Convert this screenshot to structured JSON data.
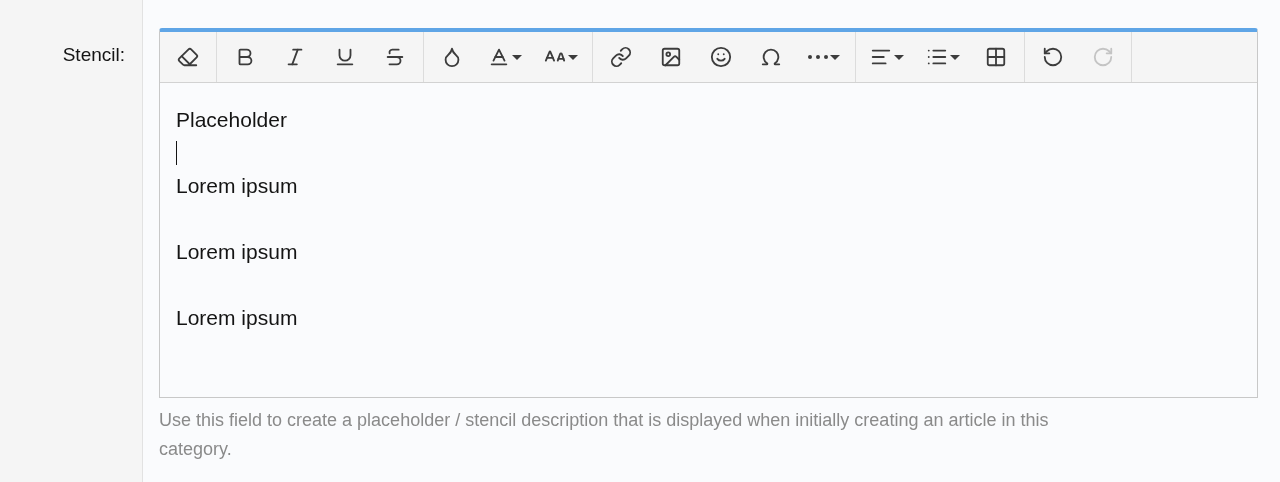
{
  "field": {
    "label": "Stencil:"
  },
  "toolbar": [
    {
      "items": [
        {
          "kind": "eraser",
          "dropdown": false,
          "disabled": false
        }
      ]
    },
    {
      "items": [
        {
          "kind": "bold",
          "dropdown": false,
          "disabled": false
        },
        {
          "kind": "italic",
          "dropdown": false,
          "disabled": false
        },
        {
          "kind": "underline",
          "dropdown": false,
          "disabled": false
        },
        {
          "kind": "strike",
          "dropdown": false,
          "disabled": false
        }
      ]
    },
    {
      "items": [
        {
          "kind": "color",
          "dropdown": false,
          "disabled": false
        },
        {
          "kind": "font",
          "dropdown": true,
          "disabled": false
        },
        {
          "kind": "size",
          "dropdown": true,
          "disabled": false
        }
      ]
    },
    {
      "items": [
        {
          "kind": "link",
          "dropdown": false,
          "disabled": false
        },
        {
          "kind": "image",
          "dropdown": false,
          "disabled": false
        },
        {
          "kind": "smiley",
          "dropdown": false,
          "disabled": false
        },
        {
          "kind": "omega",
          "dropdown": false,
          "disabled": false
        },
        {
          "kind": "more",
          "dropdown": true,
          "disabled": false
        }
      ]
    },
    {
      "items": [
        {
          "kind": "align",
          "dropdown": true,
          "disabled": false
        },
        {
          "kind": "list",
          "dropdown": true,
          "disabled": false
        },
        {
          "kind": "table",
          "dropdown": false,
          "disabled": false
        }
      ]
    },
    {
      "items": [
        {
          "kind": "undo",
          "dropdown": false,
          "disabled": false
        },
        {
          "kind": "redo",
          "dropdown": false,
          "disabled": true
        }
      ]
    }
  ],
  "content": [
    {
      "kind": "text",
      "text": "Placeholder"
    },
    {
      "kind": "caret"
    },
    {
      "kind": "text",
      "text": "Lorem ipsum"
    },
    {
      "kind": "blank"
    },
    {
      "kind": "text",
      "text": "Lorem ipsum"
    },
    {
      "kind": "blank"
    },
    {
      "kind": "text",
      "text": "Lorem ipsum"
    }
  ],
  "help": "Use this field to create a placeholder / stencil description that is displayed when initially creating an article in this category."
}
